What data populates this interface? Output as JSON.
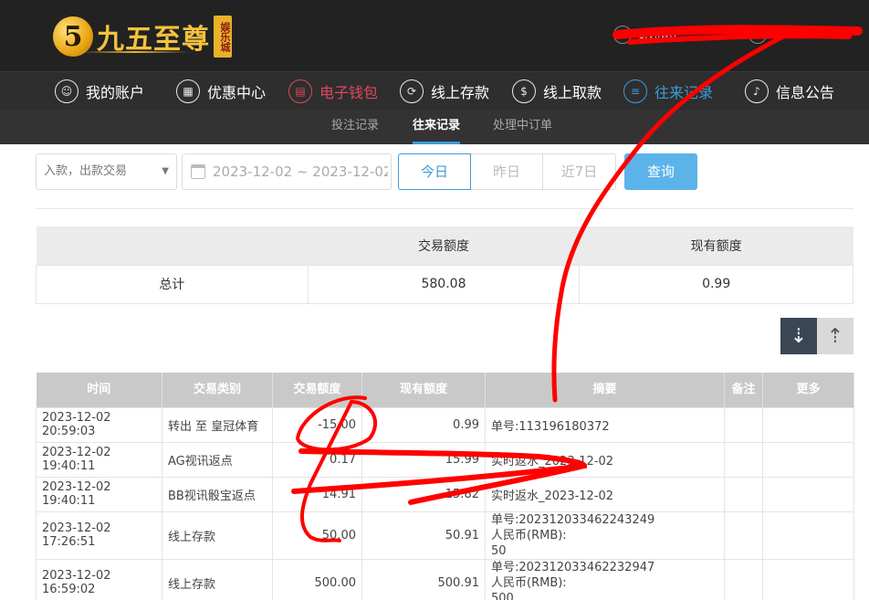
{
  "header": {
    "logo_digit": "5",
    "logo_text": "九五至尊",
    "logo_tag": "娱乐城",
    "username": "sjyljwb",
    "balance": "RMB"
  },
  "main_nav": [
    {
      "label": "我的账户",
      "icon": "user-icon"
    },
    {
      "label": "优惠中心",
      "icon": "gift-icon"
    },
    {
      "label": "电子钱包",
      "icon": "wallet-icon"
    },
    {
      "label": "线上存款",
      "icon": "deposit-icon"
    },
    {
      "label": "线上取款",
      "icon": "withdraw-icon"
    },
    {
      "label": "往来记录",
      "icon": "record-icon"
    },
    {
      "label": "信息公告",
      "icon": "bell-icon"
    }
  ],
  "sub_nav": [
    {
      "label": "投注记录"
    },
    {
      "label": "往来记录"
    },
    {
      "label": "处理中订单"
    }
  ],
  "filters": {
    "type_select": "入款，出款交易",
    "date_range": "2023-12-02 ~ 2023-12-02",
    "today": "今日",
    "yesterday": "昨日",
    "last7": "近7日",
    "query": "查询"
  },
  "summary": {
    "col_amount": "交易额度",
    "col_balance": "现有额度",
    "label": "总计",
    "amount": "580.08",
    "balance": "0.99"
  },
  "records": {
    "headers": [
      "时间",
      "交易类别",
      "交易额度",
      "现有额度",
      "摘要",
      "备注",
      "更多"
    ],
    "rows": [
      {
        "time": "2023-12-02 20:59:03",
        "type": "转出 至 皇冠体育",
        "amount": "-15.00",
        "balance": "0.99",
        "memo": [
          "单号:113196180372"
        ]
      },
      {
        "time": "2023-12-02 19:40:11",
        "type": "AG视讯返点",
        "amount": "0.17",
        "balance": "15.99",
        "memo": [
          "实时返水_2023-12-02"
        ]
      },
      {
        "time": "2023-12-02 19:40:11",
        "type": "BB视讯骰宝返点",
        "amount": "14.91",
        "balance": "15.82",
        "memo": [
          "实时返水_2023-12-02"
        ]
      },
      {
        "time": "2023-12-02 17:26:51",
        "type": "线上存款",
        "amount": "50.00",
        "balance": "50.91",
        "memo": [
          "单号:202312033462243249",
          "人民币(RMB):",
          "50"
        ]
      },
      {
        "time": "2023-12-02 16:59:02",
        "type": "线上存款",
        "amount": "500.00",
        "balance": "500.91",
        "memo": [
          "单号:202312033462232947",
          "人民币(RMB):",
          "500"
        ]
      }
    ]
  },
  "colors": {
    "header_bg": "#222222",
    "nav_active_red": "#e2465f",
    "nav_active_blue": "#3d9bd8",
    "query_button": "#5cb3ea",
    "scribble": "#ff0000"
  }
}
